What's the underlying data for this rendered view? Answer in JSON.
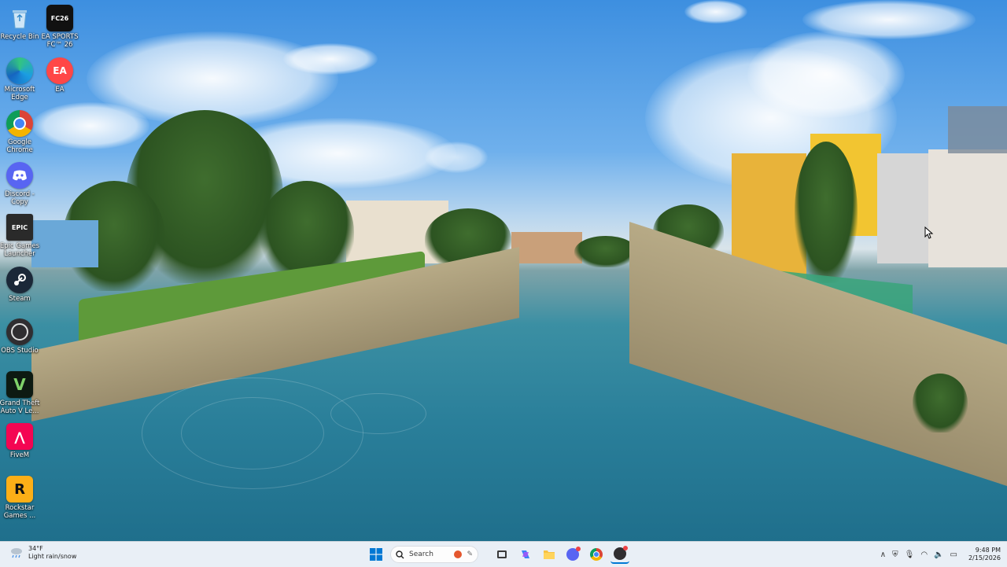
{
  "desktop": {
    "icons": [
      {
        "label": "Recycle Bin",
        "icon": "recycle-bin-icon"
      },
      {
        "label": "EA SPORTS FC™ 26",
        "icon": "ea-sports-fc-icon"
      },
      {
        "label": "Microsoft Edge",
        "icon": "edge-icon"
      },
      {
        "label": "EA",
        "icon": "ea-app-icon"
      },
      {
        "label": "Google Chrome",
        "icon": "chrome-icon"
      },
      {
        "label": "Discord - Copy",
        "icon": "discord-icon"
      },
      {
        "label": "Epic Games Launcher",
        "icon": "epic-games-icon"
      },
      {
        "label": "Steam",
        "icon": "steam-icon"
      },
      {
        "label": "OBS Studio",
        "icon": "obs-icon"
      },
      {
        "label": "Grand Theft Auto V Le...",
        "icon": "gta-icon"
      },
      {
        "label": "FiveM",
        "icon": "fivem-icon"
      },
      {
        "label": "Rockstar Games ...",
        "icon": "rockstar-icon"
      }
    ]
  },
  "taskbar": {
    "weather": {
      "temp": "34°F",
      "condition": "Light rain/snow"
    },
    "search_placeholder": "Search",
    "apps": [
      "start-icon",
      "search-icon",
      "task-view-icon",
      "copilot-icon",
      "file-explorer-icon",
      "discord-icon",
      "chrome-icon",
      "obs-icon"
    ],
    "tray": {
      "time": "9:48 PM",
      "date": "2/15/2026"
    }
  },
  "colors": {
    "taskbar_bg": "#e8eef6",
    "windows_blue": "#0078d4",
    "chrome_red": "#db4437",
    "discord": "#5865f2",
    "epic": "#2a2a2a",
    "steam": "#1b2838",
    "fivem": "#f40552",
    "rockstar": "#fcaf17"
  }
}
